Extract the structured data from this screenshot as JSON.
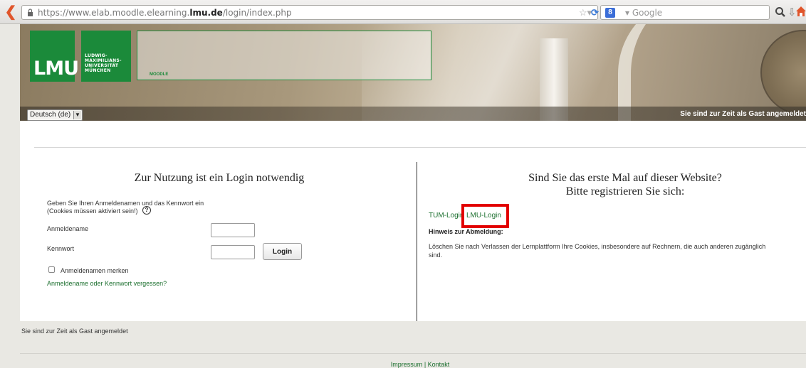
{
  "browser": {
    "url_prefix": "https://www.elab.moodle.elearning.",
    "url_domain": "lmu.de",
    "url_path": "/login/index.php",
    "search_badge": "8",
    "search_placeholder": "Google"
  },
  "header": {
    "logo_text": "LMU",
    "uni_line1": "LUDWIG-",
    "uni_line2": "MAXIMILIANS-",
    "uni_line3": "UNIVERSITÄT",
    "uni_line4": "MÜNCHEN",
    "moodle_label": "MOODLE",
    "language": "Deutsch (de)",
    "guest_notice": "Sie sind zur Zeit als Gast angemeldet"
  },
  "login": {
    "heading": "Zur Nutzung ist ein Login notwendig",
    "intro_line1": "Geben Sie Ihren Anmeldenamen und das Kennwort ein",
    "intro_line2": "(Cookies müssen aktiviert sein!)",
    "username_label": "Anmeldename",
    "username_value": "",
    "password_label": "Kennwort",
    "password_value": "",
    "button_label": "Login",
    "remember_label": "Anmeldenamen merken",
    "remember_checked": false,
    "forgot_link": "Anmeldename oder Kennwort vergessen?"
  },
  "register": {
    "heading_line1": "Sind Sie das erste Mal auf dieser Website?",
    "heading_line2": "Bitte registrieren Sie sich:",
    "tum_link": "TUM-Login",
    "lmu_link": "LMU-Login",
    "logout_title": "Hinweis zur Abmeldung:",
    "logout_text_line1": "Löschen Sie nach Verlassen der Lernplattform Ihre Cookies, insbesondere auf Rechnern, die auch anderen zugänglich",
    "logout_text_line2": "sind."
  },
  "footer": {
    "guest_notice": "Sie sind zur Zeit als Gast angemeldet",
    "impressum": "Impressum",
    "separator": "|",
    "kontakt": "Kontakt"
  },
  "colors": {
    "brand_green": "#1b8a3a",
    "link_green": "#1b6f2e",
    "highlight_red": "#e20000"
  }
}
